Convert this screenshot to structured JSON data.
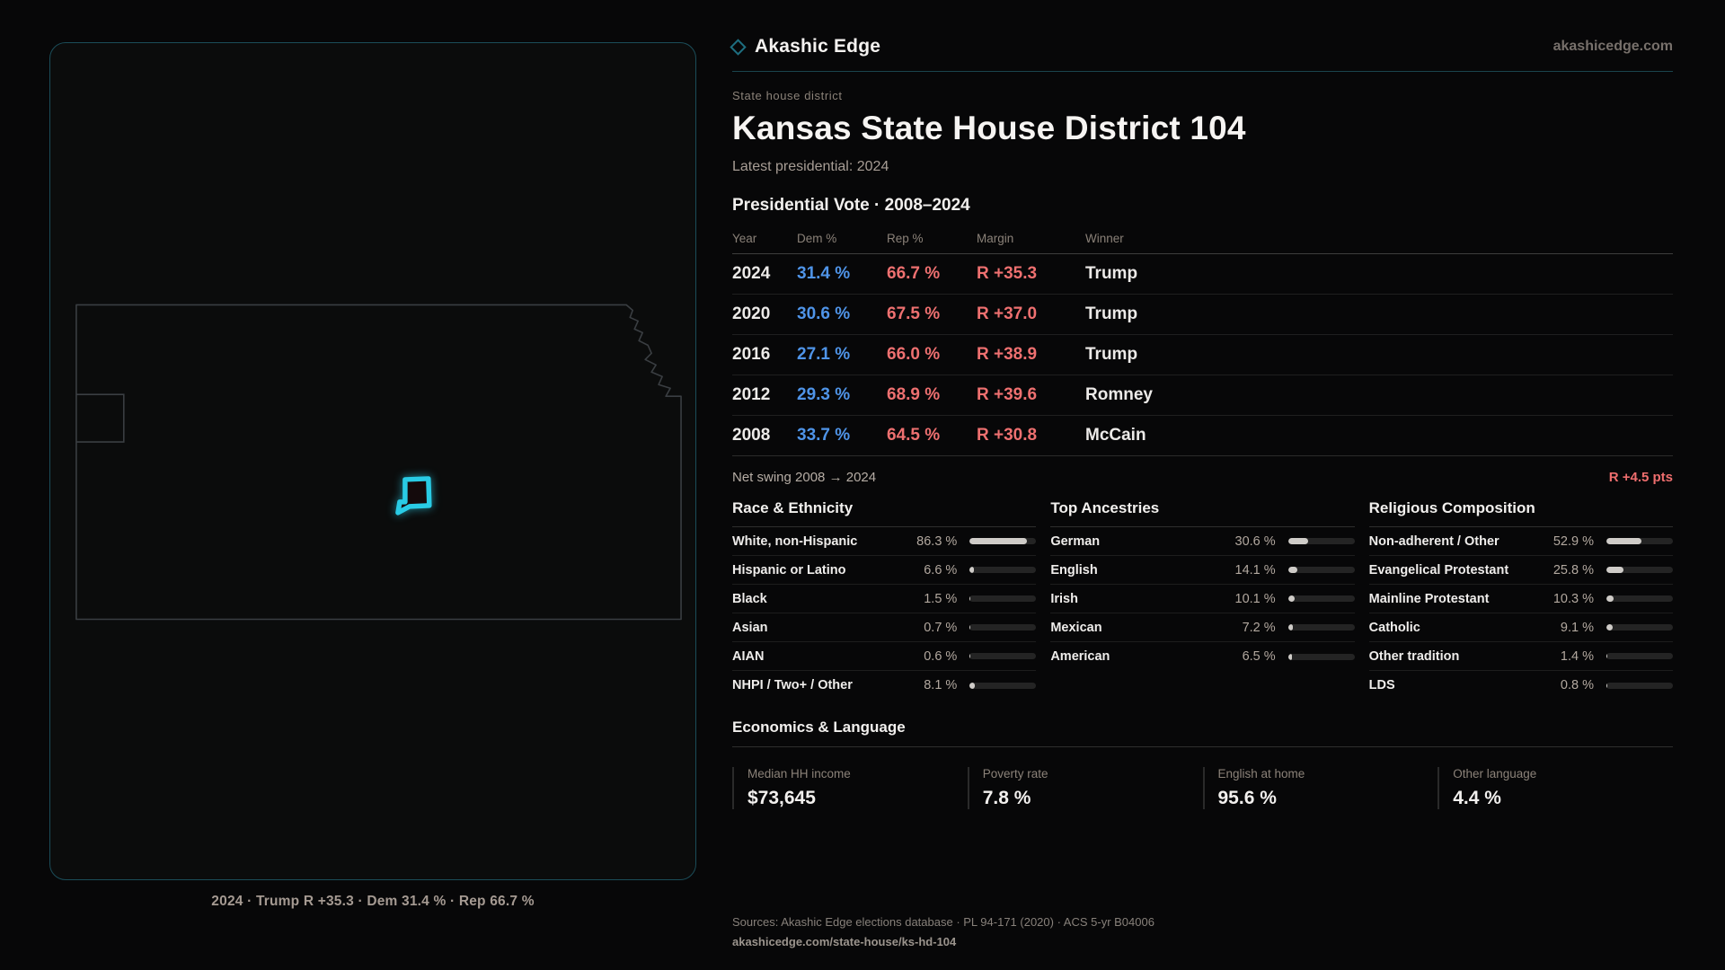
{
  "brand": {
    "name": "Akashic Edge",
    "domain": "akashicedge.com"
  },
  "header": {
    "eyebrow": "State house district",
    "title": "Kansas State House District 104",
    "subtitle": "Latest presidential: 2024"
  },
  "vote_table": {
    "section_title": "Presidential Vote · 2008–2024",
    "columns": [
      "Year",
      "Dem %",
      "Rep %",
      "Margin",
      "Winner"
    ],
    "rows": [
      {
        "year": "2024",
        "dem": "31.4 %",
        "rep": "66.7 %",
        "margin": "R +35.3",
        "winner": "Trump"
      },
      {
        "year": "2020",
        "dem": "30.6 %",
        "rep": "67.5 %",
        "margin": "R +37.0",
        "winner": "Trump"
      },
      {
        "year": "2016",
        "dem": "27.1 %",
        "rep": "66.0 %",
        "margin": "R +38.9",
        "winner": "Trump"
      },
      {
        "year": "2012",
        "dem": "29.3 %",
        "rep": "68.9 %",
        "margin": "R +39.6",
        "winner": "Romney"
      },
      {
        "year": "2008",
        "dem": "33.7 %",
        "rep": "64.5 %",
        "margin": "R +30.8",
        "winner": "McCain"
      }
    ],
    "net_swing_label": "Net swing 2008 → 2024",
    "net_swing_value": "R +4.5 pts"
  },
  "demographics": [
    {
      "title": "Race & Ethnicity",
      "rows": [
        {
          "label": "White, non-Hispanic",
          "value": "86.3 %",
          "pct": 86.3
        },
        {
          "label": "Hispanic or Latino",
          "value": "6.6 %",
          "pct": 6.6
        },
        {
          "label": "Black",
          "value": "1.5 %",
          "pct": 1.5
        },
        {
          "label": "Asian",
          "value": "0.7 %",
          "pct": 0.7
        },
        {
          "label": "AIAN",
          "value": "0.6 %",
          "pct": 0.6
        },
        {
          "label": "NHPI / Two+ / Other",
          "value": "8.1 %",
          "pct": 8.1
        }
      ]
    },
    {
      "title": "Top Ancestries",
      "rows": [
        {
          "label": "German",
          "value": "30.6 %",
          "pct": 30.6
        },
        {
          "label": "English",
          "value": "14.1 %",
          "pct": 14.1
        },
        {
          "label": "Irish",
          "value": "10.1 %",
          "pct": 10.1
        },
        {
          "label": "Mexican",
          "value": "7.2 %",
          "pct": 7.2
        },
        {
          "label": "American",
          "value": "6.5 %",
          "pct": 6.5
        }
      ]
    },
    {
      "title": "Religious Composition",
      "rows": [
        {
          "label": "Non-adherent / Other",
          "value": "52.9 %",
          "pct": 52.9
        },
        {
          "label": "Evangelical Protestant",
          "value": "25.8 %",
          "pct": 25.8
        },
        {
          "label": "Mainline Protestant",
          "value": "10.3 %",
          "pct": 10.3
        },
        {
          "label": "Catholic",
          "value": "9.1 %",
          "pct": 9.1
        },
        {
          "label": "Other tradition",
          "value": "1.4 %",
          "pct": 1.4
        },
        {
          "label": "LDS",
          "value": "0.8 %",
          "pct": 0.8
        }
      ]
    }
  ],
  "economics": {
    "title": "Economics & Language",
    "stats": [
      {
        "label": "Median HH income",
        "value": "$73,645"
      },
      {
        "label": "Poverty rate",
        "value": "7.8 %"
      },
      {
        "label": "English at home",
        "value": "95.6 %"
      },
      {
        "label": "Other language",
        "value": "4.4 %"
      }
    ]
  },
  "map": {
    "caption": "2024 · Trump R +35.3 · Dem 31.4 % · Rep 66.7 %",
    "outline_color": "#3a3e42",
    "highlight_color": "#29cbe5"
  },
  "footer": {
    "sources": "Sources: Akashic Edge elections database · PL 94-171 (2020) · ACS 5-yr B04006",
    "permalink": "akashicedge.com/state-house/ks-hd-104"
  }
}
